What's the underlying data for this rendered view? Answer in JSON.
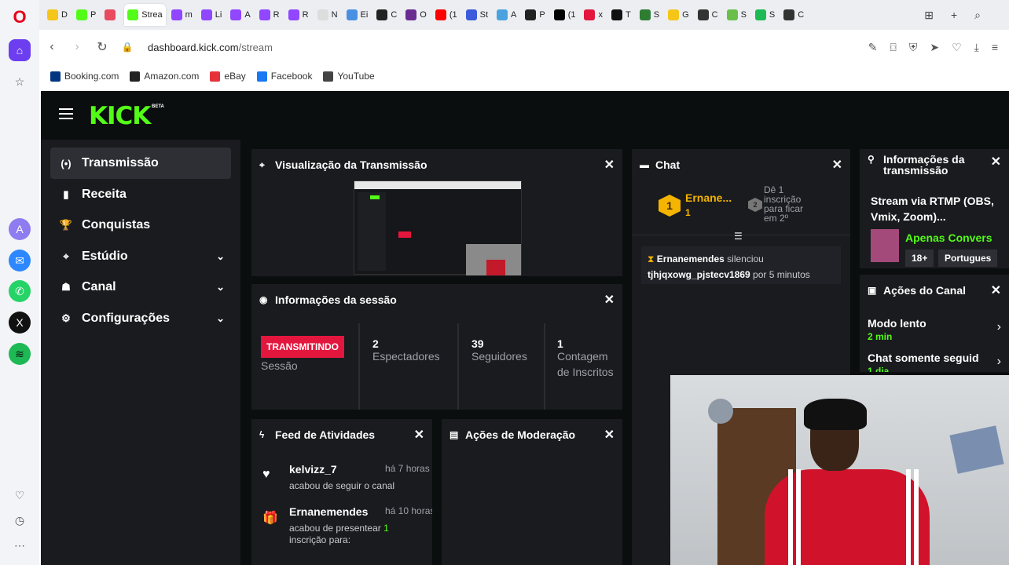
{
  "browser": {
    "tabs": [
      {
        "label": "D",
        "color": "#f5c518"
      },
      {
        "label": "P",
        "color": "#53fc18"
      },
      {
        "label": "",
        "color": "#e84a5f"
      },
      {
        "label": "Strea",
        "color": "#53fc18"
      },
      {
        "label": "m",
        "color": "#9146ff"
      },
      {
        "label": "Li",
        "color": "#9146ff"
      },
      {
        "label": "A",
        "color": "#9146ff"
      },
      {
        "label": "R",
        "color": "#9146ff"
      },
      {
        "label": "R",
        "color": "#9146ff"
      },
      {
        "label": "N",
        "color": "#dddddd"
      },
      {
        "label": "Ei",
        "color": "#4a90e2"
      },
      {
        "label": "C",
        "color": "#222222"
      },
      {
        "label": "O",
        "color": "#6a2c91"
      },
      {
        "label": "(1",
        "color": "#ff0000"
      },
      {
        "label": "St",
        "color": "#3b5bdb"
      },
      {
        "label": "A",
        "color": "#4aa3df"
      },
      {
        "label": "P",
        "color": "#222222"
      },
      {
        "label": "(1",
        "color": "#000000"
      },
      {
        "label": "x",
        "color": "#e3173e"
      },
      {
        "label": "T",
        "color": "#111111"
      },
      {
        "label": "S",
        "color": "#2e7d32"
      },
      {
        "label": "G",
        "color": "#f5c518"
      },
      {
        "label": "C",
        "color": "#333333"
      },
      {
        "label": "S",
        "color": "#6abf4b"
      },
      {
        "label": "S",
        "color": "#1db954"
      },
      {
        "label": "C",
        "color": "#333333"
      }
    ],
    "url_domain": "dashboard.kick.com",
    "url_path": "/stream",
    "bookmarks": [
      {
        "label": "Booking.com",
        "color": "#003580"
      },
      {
        "label": "Amazon.com",
        "color": "#222222"
      },
      {
        "label": "eBay",
        "color": "#e53238"
      },
      {
        "label": "Facebook",
        "color": "#1877f2"
      },
      {
        "label": "YouTube",
        "color": "#444444"
      }
    ]
  },
  "kick": {
    "logo": "KICK",
    "beta": "BETA",
    "nav": [
      {
        "label": "Transmissão",
        "icon": "(•)"
      },
      {
        "label": "Receita",
        "icon": "▮"
      },
      {
        "label": "Conquistas",
        "icon": "🏆"
      },
      {
        "label": "Estúdio",
        "icon": "⌖"
      },
      {
        "label": "Canal",
        "icon": "☗"
      },
      {
        "label": "Configurações",
        "icon": "⚙"
      }
    ],
    "preview": {
      "title": "Visualização da Transmissão"
    },
    "session": {
      "title": "Informações da sessão",
      "badge": "TRANSMITINDO",
      "badge_label": "Sessão",
      "viewers_value": "2",
      "viewers_label": "Espectadores",
      "followers_value": "39",
      "followers_label": "Seguidores",
      "subs_value": "1",
      "subs_label": "Contagem de Inscritos"
    },
    "feed": {
      "title": "Feed de Atividades",
      "items": [
        {
          "user": "kelvizz_7",
          "time": "há 7 horas",
          "desc": "acabou de seguir o canal"
        },
        {
          "user": "Ernanemendes",
          "time": "há 10 horas",
          "desc_pre": "acabou de presentear ",
          "desc_num": "1",
          "desc_post": " inscrição para:"
        }
      ]
    },
    "moderation": {
      "title": "Ações de Moderação"
    },
    "chat": {
      "title": "Chat",
      "top_user": "Ernane...",
      "top_count": "1",
      "rank_badge": "1",
      "second_badge": "2",
      "second_text": "Dê 1 inscrição para ficar em 2º",
      "msg_user": "Ernanemendes",
      "msg_action": " silenciou",
      "msg_target": "tjhjqxowg_pjstecv1869",
      "msg_duration": " por 5 minutos"
    },
    "stream_info": {
      "title": "Informações da transmissão",
      "stream_title": "Stream via RTMP (OBS, Vmix, Zoom)...",
      "category": "Apenas Convers",
      "tag1": "18+",
      "tag2": "Portugues"
    },
    "channel_actions": {
      "title": "Ações do Canal",
      "slow_label": "Modo lento",
      "slow_value": "2 min",
      "followers_label": "Chat somente seguid",
      "followers_value": "1 dia"
    }
  }
}
